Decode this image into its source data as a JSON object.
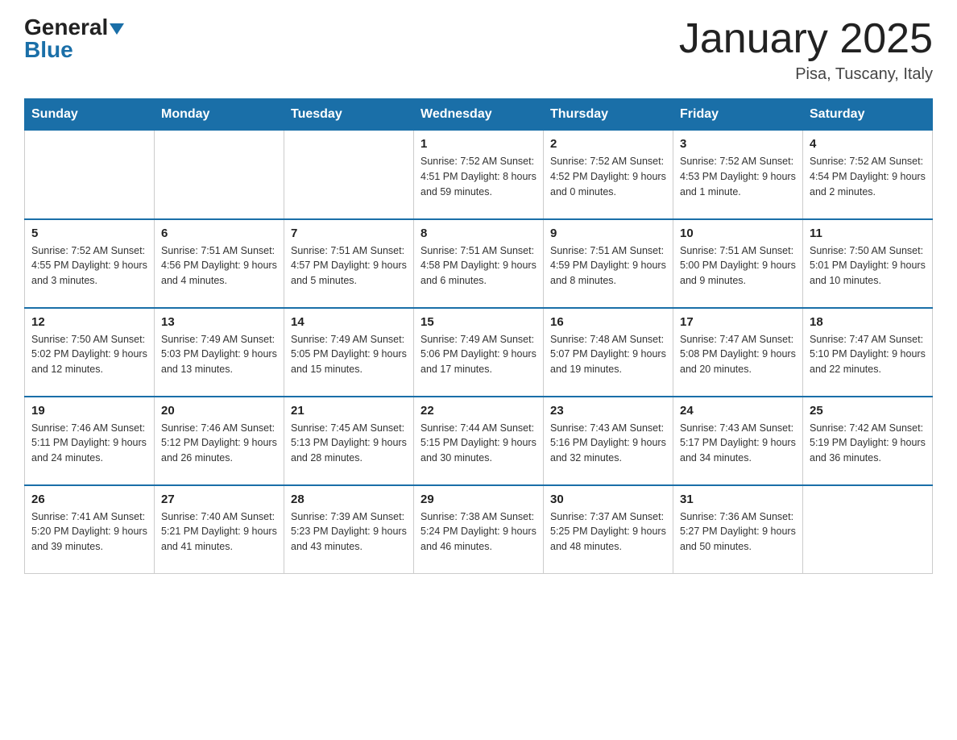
{
  "header": {
    "title": "January 2025",
    "subtitle": "Pisa, Tuscany, Italy",
    "logo_general": "General",
    "logo_blue": "Blue"
  },
  "days_of_week": [
    "Sunday",
    "Monday",
    "Tuesday",
    "Wednesday",
    "Thursday",
    "Friday",
    "Saturday"
  ],
  "weeks": [
    [
      {
        "num": "",
        "info": ""
      },
      {
        "num": "",
        "info": ""
      },
      {
        "num": "",
        "info": ""
      },
      {
        "num": "1",
        "info": "Sunrise: 7:52 AM\nSunset: 4:51 PM\nDaylight: 8 hours\nand 59 minutes."
      },
      {
        "num": "2",
        "info": "Sunrise: 7:52 AM\nSunset: 4:52 PM\nDaylight: 9 hours\nand 0 minutes."
      },
      {
        "num": "3",
        "info": "Sunrise: 7:52 AM\nSunset: 4:53 PM\nDaylight: 9 hours\nand 1 minute."
      },
      {
        "num": "4",
        "info": "Sunrise: 7:52 AM\nSunset: 4:54 PM\nDaylight: 9 hours\nand 2 minutes."
      }
    ],
    [
      {
        "num": "5",
        "info": "Sunrise: 7:52 AM\nSunset: 4:55 PM\nDaylight: 9 hours\nand 3 minutes."
      },
      {
        "num": "6",
        "info": "Sunrise: 7:51 AM\nSunset: 4:56 PM\nDaylight: 9 hours\nand 4 minutes."
      },
      {
        "num": "7",
        "info": "Sunrise: 7:51 AM\nSunset: 4:57 PM\nDaylight: 9 hours\nand 5 minutes."
      },
      {
        "num": "8",
        "info": "Sunrise: 7:51 AM\nSunset: 4:58 PM\nDaylight: 9 hours\nand 6 minutes."
      },
      {
        "num": "9",
        "info": "Sunrise: 7:51 AM\nSunset: 4:59 PM\nDaylight: 9 hours\nand 8 minutes."
      },
      {
        "num": "10",
        "info": "Sunrise: 7:51 AM\nSunset: 5:00 PM\nDaylight: 9 hours\nand 9 minutes."
      },
      {
        "num": "11",
        "info": "Sunrise: 7:50 AM\nSunset: 5:01 PM\nDaylight: 9 hours\nand 10 minutes."
      }
    ],
    [
      {
        "num": "12",
        "info": "Sunrise: 7:50 AM\nSunset: 5:02 PM\nDaylight: 9 hours\nand 12 minutes."
      },
      {
        "num": "13",
        "info": "Sunrise: 7:49 AM\nSunset: 5:03 PM\nDaylight: 9 hours\nand 13 minutes."
      },
      {
        "num": "14",
        "info": "Sunrise: 7:49 AM\nSunset: 5:05 PM\nDaylight: 9 hours\nand 15 minutes."
      },
      {
        "num": "15",
        "info": "Sunrise: 7:49 AM\nSunset: 5:06 PM\nDaylight: 9 hours\nand 17 minutes."
      },
      {
        "num": "16",
        "info": "Sunrise: 7:48 AM\nSunset: 5:07 PM\nDaylight: 9 hours\nand 19 minutes."
      },
      {
        "num": "17",
        "info": "Sunrise: 7:47 AM\nSunset: 5:08 PM\nDaylight: 9 hours\nand 20 minutes."
      },
      {
        "num": "18",
        "info": "Sunrise: 7:47 AM\nSunset: 5:10 PM\nDaylight: 9 hours\nand 22 minutes."
      }
    ],
    [
      {
        "num": "19",
        "info": "Sunrise: 7:46 AM\nSunset: 5:11 PM\nDaylight: 9 hours\nand 24 minutes."
      },
      {
        "num": "20",
        "info": "Sunrise: 7:46 AM\nSunset: 5:12 PM\nDaylight: 9 hours\nand 26 minutes."
      },
      {
        "num": "21",
        "info": "Sunrise: 7:45 AM\nSunset: 5:13 PM\nDaylight: 9 hours\nand 28 minutes."
      },
      {
        "num": "22",
        "info": "Sunrise: 7:44 AM\nSunset: 5:15 PM\nDaylight: 9 hours\nand 30 minutes."
      },
      {
        "num": "23",
        "info": "Sunrise: 7:43 AM\nSunset: 5:16 PM\nDaylight: 9 hours\nand 32 minutes."
      },
      {
        "num": "24",
        "info": "Sunrise: 7:43 AM\nSunset: 5:17 PM\nDaylight: 9 hours\nand 34 minutes."
      },
      {
        "num": "25",
        "info": "Sunrise: 7:42 AM\nSunset: 5:19 PM\nDaylight: 9 hours\nand 36 minutes."
      }
    ],
    [
      {
        "num": "26",
        "info": "Sunrise: 7:41 AM\nSunset: 5:20 PM\nDaylight: 9 hours\nand 39 minutes."
      },
      {
        "num": "27",
        "info": "Sunrise: 7:40 AM\nSunset: 5:21 PM\nDaylight: 9 hours\nand 41 minutes."
      },
      {
        "num": "28",
        "info": "Sunrise: 7:39 AM\nSunset: 5:23 PM\nDaylight: 9 hours\nand 43 minutes."
      },
      {
        "num": "29",
        "info": "Sunrise: 7:38 AM\nSunset: 5:24 PM\nDaylight: 9 hours\nand 46 minutes."
      },
      {
        "num": "30",
        "info": "Sunrise: 7:37 AM\nSunset: 5:25 PM\nDaylight: 9 hours\nand 48 minutes."
      },
      {
        "num": "31",
        "info": "Sunrise: 7:36 AM\nSunset: 5:27 PM\nDaylight: 9 hours\nand 50 minutes."
      },
      {
        "num": "",
        "info": ""
      }
    ]
  ]
}
